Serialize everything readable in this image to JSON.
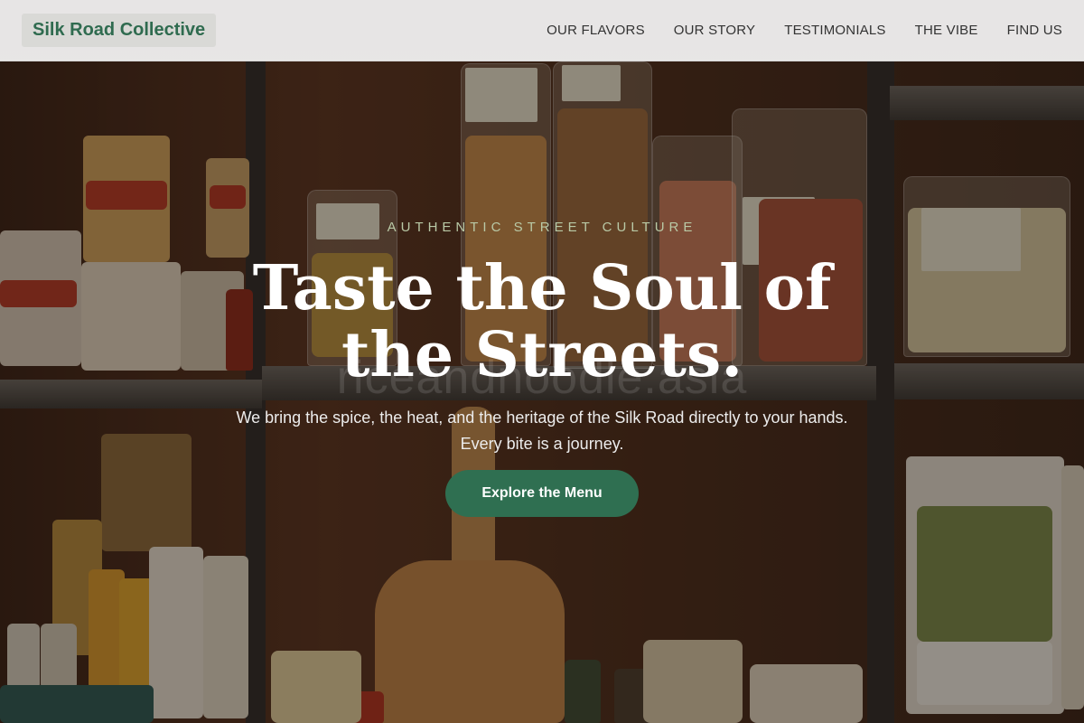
{
  "brand": {
    "name": "Silk Road Collective"
  },
  "nav": {
    "items": [
      {
        "label": "OUR FLAVORS"
      },
      {
        "label": "OUR STORY"
      },
      {
        "label": "TESTIMONIALS"
      },
      {
        "label": "THE VIBE"
      },
      {
        "label": "FIND US"
      }
    ]
  },
  "hero": {
    "kicker": "AUTHENTIC STREET CULTURE",
    "headline": "Taste the Soul of the Streets.",
    "watermark": "riceandnoodle.asia",
    "subtitle": "We bring the spice, the heat, and the heritage of the Silk Road directly to your hands. Every bite is a journey.",
    "cta_label": "Explore the Menu"
  },
  "colors": {
    "brand_green": "#2f6b4f",
    "cta_green": "#2f6f51",
    "kicker_green": "#b9c9a6"
  }
}
